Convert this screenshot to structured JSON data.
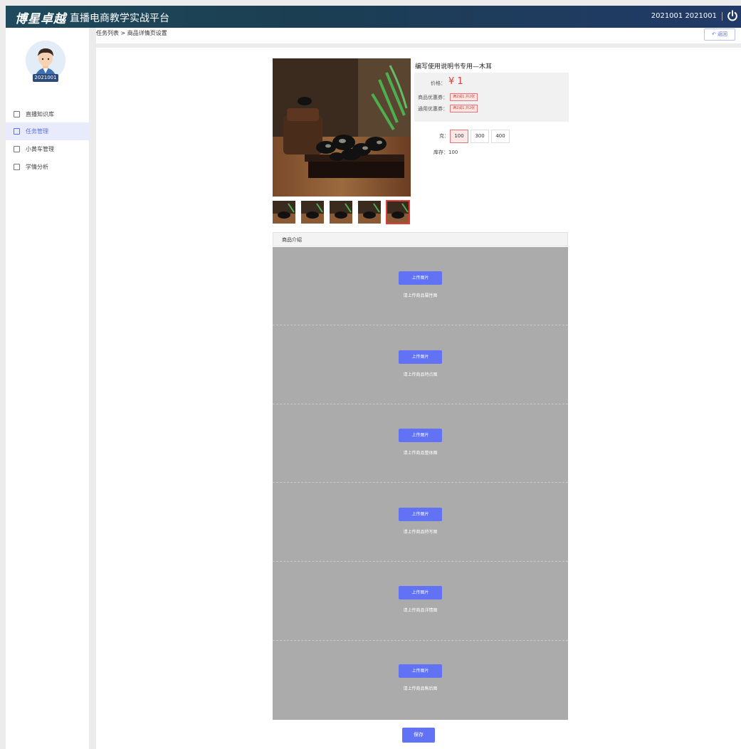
{
  "header": {
    "brand": "博星卓越",
    "platform": "直播电商教学实战平台",
    "user": "2021001 2021001"
  },
  "sidebar": {
    "avatar_badge": "2021001",
    "items": [
      {
        "label": "直播知识库",
        "icon": "book-icon",
        "active": false
      },
      {
        "label": "任务管理",
        "icon": "task-icon",
        "active": true
      },
      {
        "label": "小黄车管理",
        "icon": "cart-icon",
        "active": false
      },
      {
        "label": "学情分析",
        "icon": "analysis-icon",
        "active": false
      }
    ]
  },
  "breadcrumb": "任务列表 > 商品详情页设置",
  "back_label": "返回",
  "product": {
    "title": "编写使用说明书专用—木耳",
    "price_label": "价格：",
    "price": "¥ 1",
    "coupon_label": "商品优惠券：",
    "coupon_value": "满2减1,共2张",
    "general_coupon_label": "通用优惠券：",
    "general_coupon_value": "满2减1,共2张",
    "spec_label": "克：",
    "specs": [
      "100",
      "300",
      "400"
    ],
    "selected_spec": "100",
    "stock": "库存：100",
    "thumb_count": 5,
    "selected_thumb": 5
  },
  "intro": {
    "heading": "商品介绍",
    "upload_label": "上传图片",
    "slots": [
      "请上传商品属性图",
      "请上传商品特点图",
      "请上传商品整体图",
      "请上传商品特写图",
      "请上传商品详情图",
      "请上传商品售后图"
    ]
  },
  "save_label": "保存",
  "colors": {
    "accent": "#6272f5",
    "price_red": "#e53935",
    "header_start": "#1f4a5c",
    "header_end": "#223a68"
  }
}
